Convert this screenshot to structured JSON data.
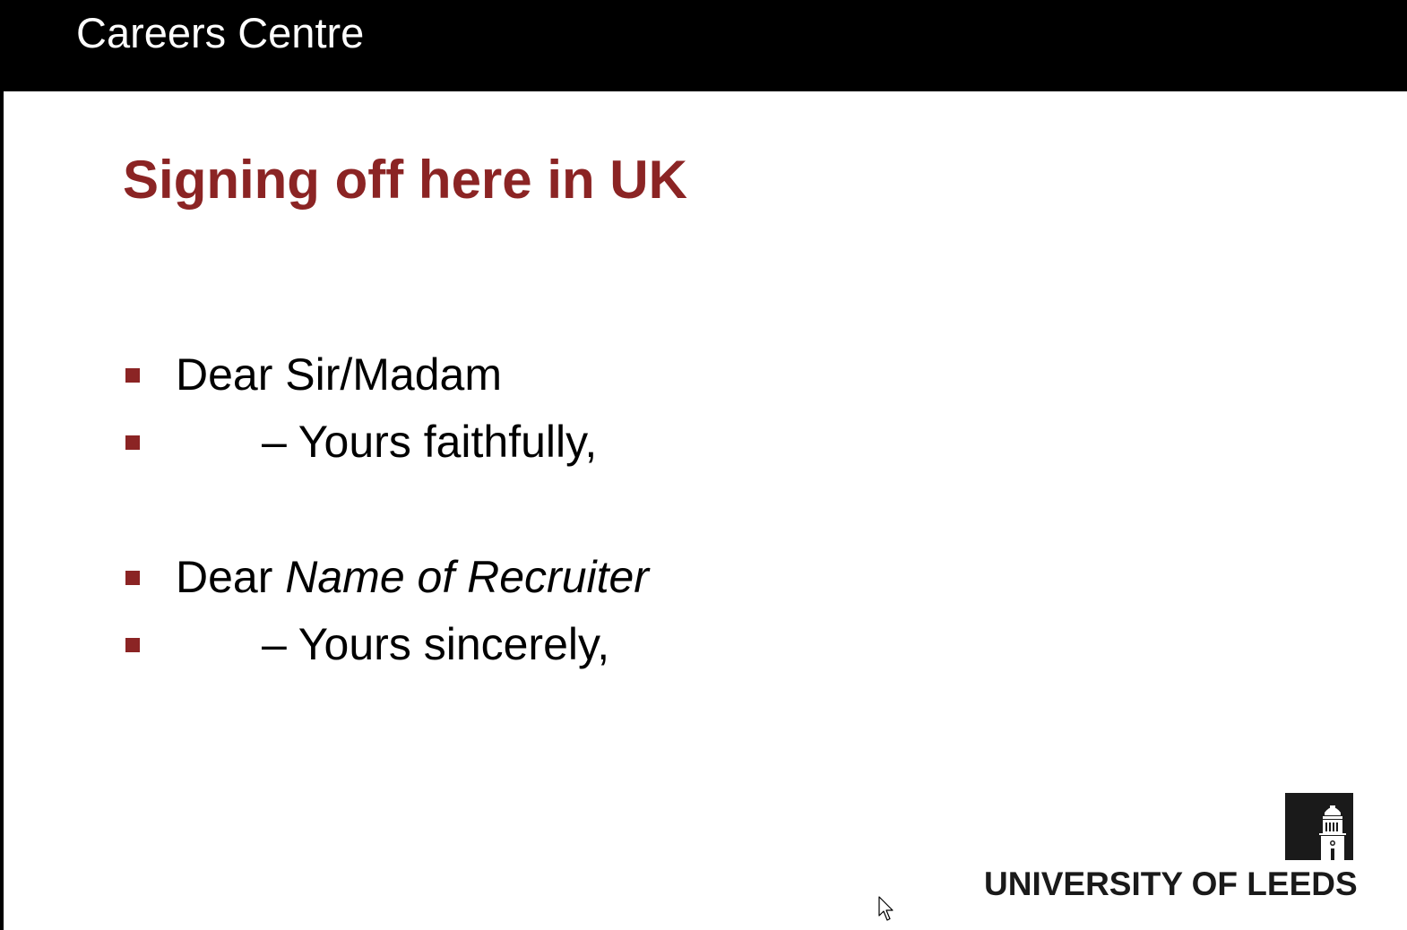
{
  "header": {
    "title": "Careers Centre"
  },
  "slide": {
    "title": "Signing off here in UK",
    "bullets": [
      {
        "text": "Dear Sir/Madam"
      },
      {
        "text": "– Yours faithfully,"
      },
      {
        "prefix": "Dear ",
        "italic": "Name of Recruiter"
      },
      {
        "text": "– Yours sincerely,"
      }
    ]
  },
  "footer": {
    "logo_text": "UNIVERSITY OF LEEDS"
  },
  "colors": {
    "accent": "#8b2424",
    "header_bg": "#000000",
    "text": "#000000"
  },
  "icons": {
    "bullet": "square-bullet-icon",
    "crest": "university-tower-crest-icon",
    "cursor": "mouse-pointer-icon"
  }
}
